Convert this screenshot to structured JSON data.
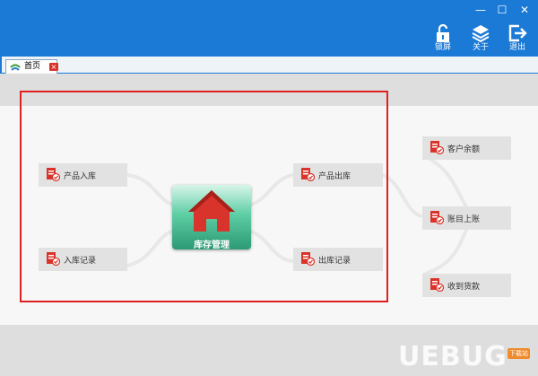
{
  "window": {
    "minimize": "—",
    "maximize": "☐",
    "close": "✕"
  },
  "toolbar": {
    "lock_label": "锁屏",
    "about_label": "关于",
    "exit_label": "退出"
  },
  "tabs": [
    {
      "label": "首页",
      "close": "×"
    }
  ],
  "center": {
    "label": "库存管理"
  },
  "nodes": {
    "product_in": "产品入库",
    "in_records": "入库记录",
    "product_out": "产品出库",
    "out_records": "出库记录",
    "customer_balance": "客户余额",
    "account_book": "账目上账",
    "payment_received": "收到货款"
  },
  "watermark": {
    "text": "UEBUG",
    "badge": "下载站"
  },
  "colors": {
    "titlebar": "#1a7ad6",
    "highlight_box": "#e02020",
    "tile_accent": "#d9342b"
  }
}
